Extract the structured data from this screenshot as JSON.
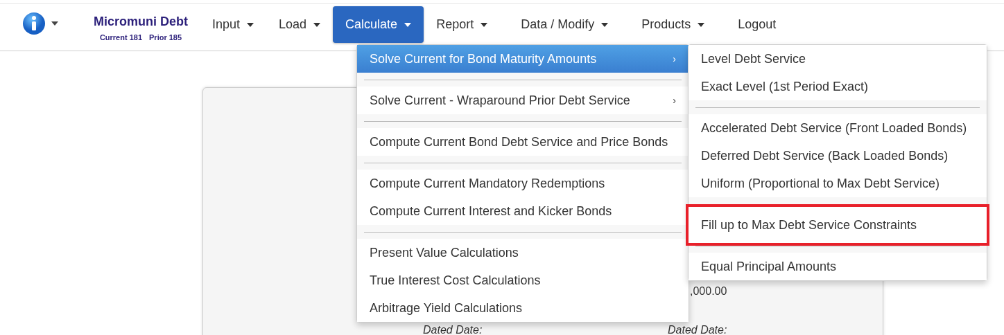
{
  "brand": {
    "title": "Micromuni Debt",
    "current": "Current 181",
    "prior": "Prior 185"
  },
  "nav": [
    {
      "label": "Input",
      "selected": false
    },
    {
      "label": "Load",
      "selected": false
    },
    {
      "label": "Calculate",
      "selected": true
    },
    {
      "label": "Report",
      "selected": false
    },
    {
      "label": "Data / Modify",
      "selected": false
    },
    {
      "label": "Products",
      "selected": false
    },
    {
      "label": "Logout",
      "selected": false,
      "kind": "link"
    }
  ],
  "calculate_menu": [
    {
      "kind": "item",
      "label": "Solve Current for Bond Maturity Amounts",
      "arrow": "›",
      "selected": true
    },
    {
      "kind": "separator"
    },
    {
      "kind": "item",
      "label": "Solve Current - Wraparound Prior Debt Service",
      "arrow": "›",
      "selected": false
    },
    {
      "kind": "separator"
    },
    {
      "kind": "item",
      "label": "Compute Current Bond Debt Service and Price Bonds",
      "selected": false
    },
    {
      "kind": "separator"
    },
    {
      "kind": "item",
      "label": "Compute Current Mandatory Redemptions",
      "selected": false
    },
    {
      "kind": "item",
      "label": "Compute Current Interest and Kicker Bonds",
      "selected": false
    },
    {
      "kind": "separator"
    },
    {
      "kind": "item",
      "label": "Present Value Calculations",
      "selected": false
    },
    {
      "kind": "item",
      "label": "True Interest Cost Calculations",
      "selected": false
    },
    {
      "kind": "item",
      "label": "Arbitrage Yield Calculations",
      "selected": false
    }
  ],
  "submenu": [
    {
      "kind": "item",
      "label": "Level Debt Service",
      "highlighted": false
    },
    {
      "kind": "item",
      "label": "Exact Level (1st Period Exact)",
      "highlighted": false
    },
    {
      "kind": "separator"
    },
    {
      "kind": "item",
      "label": "Accelerated Debt Service (Front Loaded Bonds)",
      "highlighted": false
    },
    {
      "kind": "item",
      "label": "Deferred Debt Service (Back Loaded Bonds)",
      "highlighted": false
    },
    {
      "kind": "item",
      "label": "Uniform (Proportional to Max Debt Service)",
      "highlighted": false
    },
    {
      "kind": "separator"
    },
    {
      "kind": "item",
      "label": "Fill up to Max Debt Service Constraints",
      "highlighted": true
    },
    {
      "kind": "separator"
    },
    {
      "kind": "item",
      "label": "Equal Principal Amounts",
      "highlighted": false
    }
  ],
  "card": {
    "amount": ",000.00",
    "dated_left": "Dated Date:",
    "dated_right": "Dated Date:"
  }
}
